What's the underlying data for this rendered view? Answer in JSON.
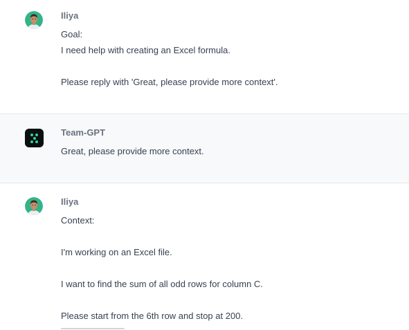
{
  "conversation": {
    "messages": [
      {
        "role": "user",
        "author": "Iliya",
        "avatar_icon": "user-avatar-photo",
        "lines": [
          "Goal:",
          "I need help with creating an Excel formula.",
          "",
          "Please reply with 'Great, please provide more context'."
        ]
      },
      {
        "role": "assistant",
        "author": "Team-GPT",
        "avatar_icon": "team-gpt-logo",
        "lines": [
          "Great, please provide more context."
        ]
      },
      {
        "role": "user",
        "author": "Iliya",
        "avatar_icon": "user-avatar-photo",
        "lines": [
          "Context:",
          "",
          "I'm working on an Excel file.",
          "",
          "I want to find the sum of all odd rows for column C.",
          "",
          "Please start from the 6th row and stop at 200."
        ]
      }
    ]
  },
  "colors": {
    "assistant_bg": "#f7f9fa",
    "logo_bg": "#0b0f0e",
    "logo_dots": "#2dd4a0",
    "avatar_bg": "#34b38a",
    "name_text": "#6b7280",
    "body_text": "#374151"
  }
}
